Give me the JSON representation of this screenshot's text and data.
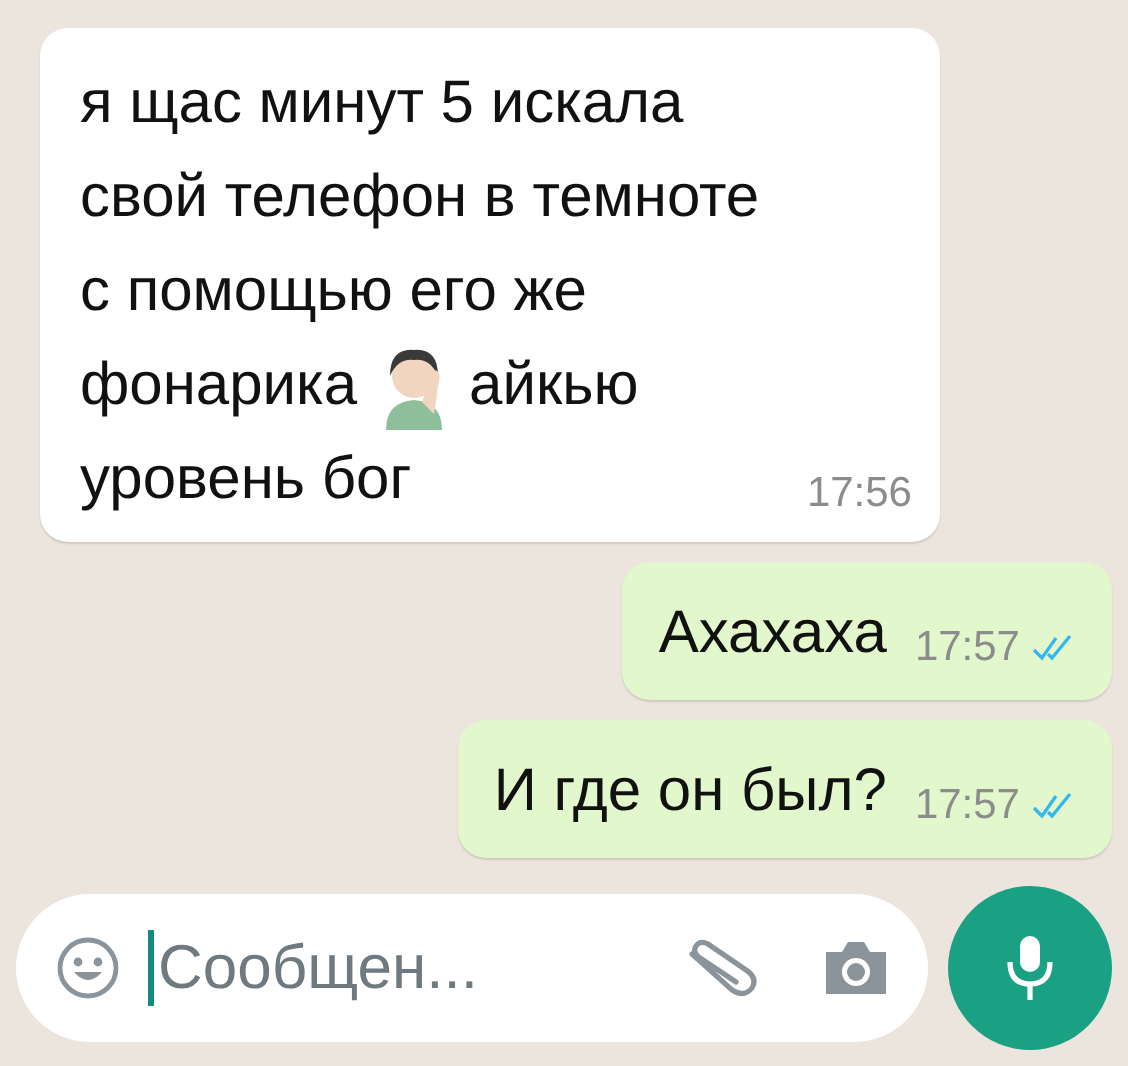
{
  "messages": [
    {
      "outgoing": false,
      "lines": [
        {
          "text": "я щас минут 5 искала"
        },
        {
          "text": "свой телефон в темноте"
        },
        {
          "text": "с помощью его же"
        },
        {
          "text": "фонарика",
          "emoji": true,
          "text_after": "айкью"
        },
        {
          "text": "уровень бог"
        }
      ],
      "time": "17:56"
    },
    {
      "outgoing": true,
      "lines": [
        {
          "text": "Ахахаха"
        }
      ],
      "time": "17:57",
      "read": true
    },
    {
      "outgoing": true,
      "lines": [
        {
          "text": "И где он был?"
        }
      ],
      "time": "17:57",
      "read": true
    }
  ],
  "composer": {
    "placeholder": "Сообщен..."
  }
}
